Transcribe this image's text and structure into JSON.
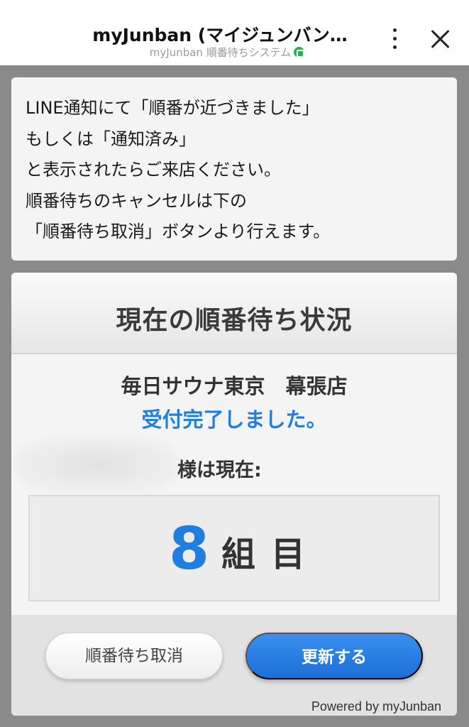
{
  "header": {
    "title": "myJunban (マイジュンバン…",
    "subtitle": "myJunban 順番待ちシステム",
    "more_icon": "more-vertical-icon",
    "close_icon": "close-icon",
    "verified_color": "#2bb24c"
  },
  "notice": {
    "lines": [
      "LINE通知にて「順番が近づきました」",
      "もしくは「通知済み」",
      "と表示されたらご来店ください。",
      "順番待ちのキャンセルは下の",
      "「順番待ち取消」ボタンより行えます。"
    ]
  },
  "status": {
    "heading": "現在の順番待ち状況",
    "store": "毎日サウナ東京　幕張店",
    "accepted": "受付完了しました。",
    "name_suffix": "様は現在:",
    "count": "8",
    "count_unit": "組目",
    "accent_color": "#1f7ee0"
  },
  "buttons": {
    "cancel_label": "順番待ち取消",
    "refresh_label": "更新する"
  },
  "footer": {
    "powered": "Powered by myJunban"
  }
}
